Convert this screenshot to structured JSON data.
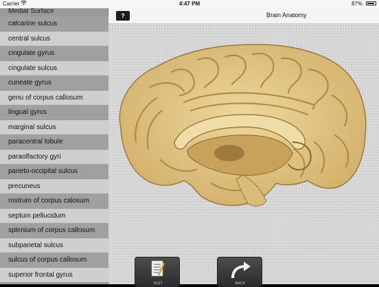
{
  "status_bar": {
    "carrier": "Carrier",
    "time": "4:47 PM",
    "battery_percent": "87%",
    "battery_level": 0.87,
    "wifi_icon": "wifi-icon"
  },
  "sidebar": {
    "title": "Medial Surface",
    "items": [
      {
        "label": "calcarine sulcus"
      },
      {
        "label": "central sulcus"
      },
      {
        "label": "cingulate gyrus"
      },
      {
        "label": "cingulate sulcus"
      },
      {
        "label": "cuneate gyrus"
      },
      {
        "label": "genu of corpus callosum"
      },
      {
        "label": "lingual gyrus"
      },
      {
        "label": "marginal sulcus"
      },
      {
        "label": "paracentral lobule"
      },
      {
        "label": "paraolfactory gyri"
      },
      {
        "label": "parieto-occipital sulcus"
      },
      {
        "label": "precuneus"
      },
      {
        "label": "rostrum of corpus calosum"
      },
      {
        "label": "septum pellucidum"
      },
      {
        "label": "splenium of corpus callosum"
      },
      {
        "label": "subparietal sulcus"
      },
      {
        "label": "sulcus of corpus callosum"
      },
      {
        "label": "superior frontal gyrus"
      }
    ]
  },
  "nav_bar": {
    "help_label": "?",
    "title": "Brain Anatomy"
  },
  "toolbar": {
    "test_label": "TEST",
    "test_icon": "notepad-pencil-icon",
    "back_label": "BACK",
    "back_icon": "curved-arrow-icon"
  },
  "colors": {
    "sidebar_bg": "#9a9a9a",
    "main_bg": "#d9d9d9",
    "brain": "#e3c98a",
    "brain_shadow": "#b08c45"
  }
}
